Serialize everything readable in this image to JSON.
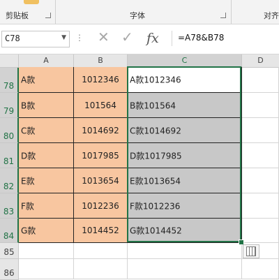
{
  "ribbon": {
    "groups": [
      {
        "label": "剪贴板"
      },
      {
        "label": "字体"
      },
      {
        "label": "对齐"
      }
    ]
  },
  "formula_bar": {
    "name_box": "C78",
    "formula": "=A78&B78",
    "fx_label": "fx",
    "cancel_icon": "✕",
    "enter_icon": "✓"
  },
  "sheet": {
    "columns": [
      "A",
      "B",
      "C",
      "D"
    ],
    "selected_column": "C",
    "rows": [
      {
        "num": "78",
        "a": "A款",
        "b": "1012346",
        "c": "A款1012346"
      },
      {
        "num": "79",
        "a": "B款",
        "b": "101564",
        "c": "B款101564"
      },
      {
        "num": "80",
        "a": "C款",
        "b": "1014692",
        "c": "C款1014692"
      },
      {
        "num": "81",
        "a": "D款",
        "b": "1017985",
        "c": "D款1017985"
      },
      {
        "num": "82",
        "a": "E款",
        "b": "1013654",
        "c": "E款1013654"
      },
      {
        "num": "83",
        "a": "F款",
        "b": "1012236",
        "c": "F款1012236"
      },
      {
        "num": "84",
        "a": "G款",
        "b": "1014452",
        "c": "G款1014452"
      },
      {
        "num": "85",
        "a": "",
        "b": "",
        "c": ""
      },
      {
        "num": "86",
        "a": "",
        "b": "",
        "c": ""
      }
    ]
  },
  "colors": {
    "fill_orange": "#f8c6a0",
    "selection_gray": "#c8c8c8",
    "excel_green": "#217346"
  }
}
